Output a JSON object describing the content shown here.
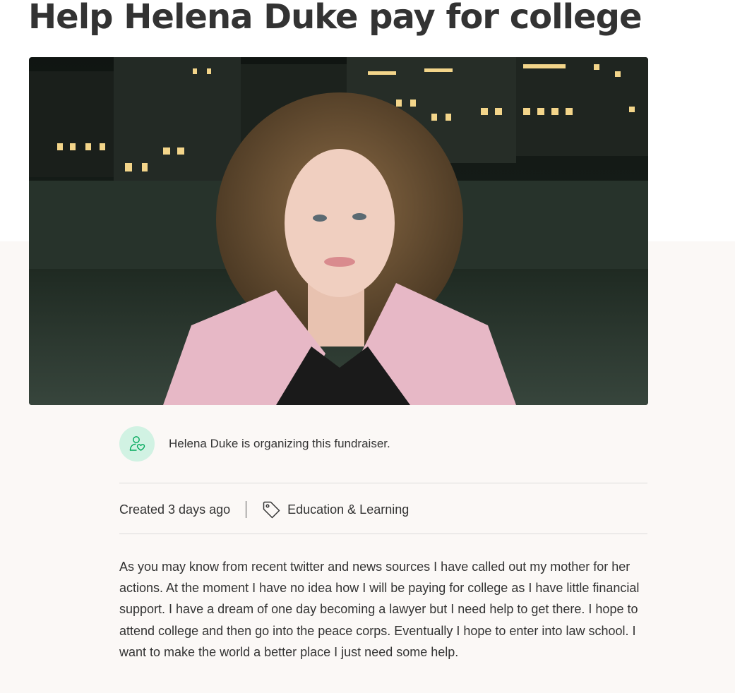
{
  "page": {
    "title": "Help Helena Duke pay for college"
  },
  "hero_image": {
    "alt": "Helena Duke standing in front of city buildings at night"
  },
  "organizer": {
    "text": "Helena Duke is organizing this fundraiser.",
    "icon": "person-heart-icon"
  },
  "meta": {
    "created": "Created 3 days ago",
    "category": "Education & Learning",
    "category_icon": "tag-icon"
  },
  "story": {
    "text": "As you may know from recent twitter and news sources I have called out my mother for her actions. At the moment I have no idea how I will be paying for college as I have little financial support. I have a dream of one day becoming a lawyer but I need help to get there. I hope to attend college and then go into the peace corps. Eventually I hope to enter into law school. I want to make the world a better place I just need some help."
  },
  "colors": {
    "accent": "#02a95c",
    "avatar_bg": "#d1f2e3",
    "lower_bg": "#fbf8f6",
    "text": "#333333"
  }
}
